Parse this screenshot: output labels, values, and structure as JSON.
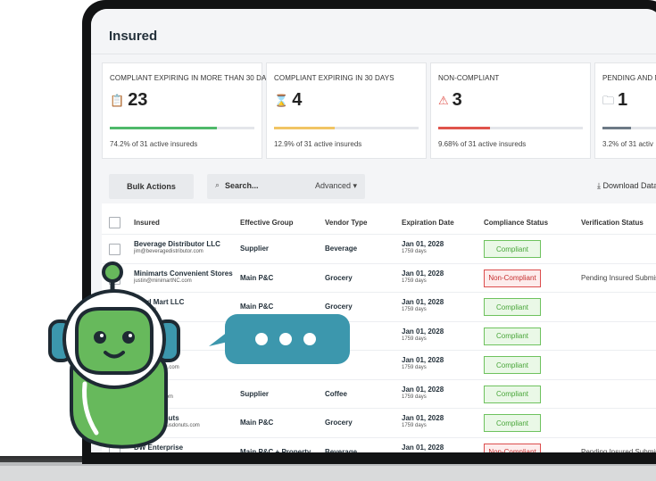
{
  "page_title": "Insured",
  "cards": [
    {
      "label": "COMPLIANT EXPIRING IN MORE THAN 30 DAYS",
      "value": "23",
      "icon": "clipboard-icon",
      "icon_glyph": "📋",
      "fraction": 0.742,
      "color": "#4fb96a",
      "sub": "74.2% of 31 active insureds"
    },
    {
      "label": "COMPLIANT EXPIRING IN 30 DAYS",
      "value": "4",
      "icon": "hourglass-icon",
      "icon_glyph": "⌛",
      "fraction": 0.42,
      "color": "#f1c564",
      "sub": "12.9% of 31 active insureds"
    },
    {
      "label": "NON-COMPLIANT",
      "value": "3",
      "icon": "warning-icon",
      "icon_glyph": "⚠",
      "fraction": 0.36,
      "color": "#e0534c",
      "sub": "9.68% of 31 active insureds"
    },
    {
      "label": "PENDING AND NE",
      "value": "1",
      "icon": "folder-icon",
      "icon_glyph": "🗀",
      "fraction": 0.2,
      "color": "#6d7a86",
      "sub": "3.2% of 31 activ"
    }
  ],
  "toolbar": {
    "bulk_actions": "Bulk Actions",
    "search_placeholder": "Search...",
    "advanced": "Advanced ▾",
    "download": "Download Data"
  },
  "table": {
    "headers": {
      "insured": "Insured",
      "group": "Effective Group",
      "vendor": "Vendor Type",
      "expiration": "Expiration Date",
      "compliance": "Compliance Status",
      "verification": "Verification Status"
    },
    "rows": [
      {
        "name": "Beverage Distributor LLC",
        "email": "jim@beveragedistributor.com",
        "group": "Supplier",
        "vendor": "Beverage",
        "date": "Jan 01, 2028",
        "days": "1759 days",
        "status": "Compliant",
        "ok": true,
        "verification": ""
      },
      {
        "name": "Minimarts Convenient Stores",
        "email": "justin@minimartNC.com",
        "group": "Main P&C",
        "vendor": "Grocery",
        "date": "Jan 01, 2028",
        "days": "1759 days",
        "status": "Non-Compliant",
        "ok": false,
        "verification": "Pending Insured Submissi"
      },
      {
        "name": "Food Mart LLC",
        "email": "mart.com",
        "group": "Main P&C",
        "vendor": "Grocery",
        "date": "Jan 01, 2028",
        "days": "1759 days",
        "status": "Compliant",
        "ok": true,
        "verification": ""
      },
      {
        "name": "",
        "email": "",
        "group": "",
        "vendor": "",
        "date": "Jan 01, 2028",
        "days": "1759 days",
        "status": "Compliant",
        "ok": true,
        "verification": ""
      },
      {
        "name": "Marts LLC",
        "email": "nvenientmarts.com",
        "group": "",
        "vendor": "",
        "date": "Jan 01, 2028",
        "days": "1759 days",
        "status": "Compliant",
        "ok": true,
        "verification": ""
      },
      {
        "name": "ess LLC",
        "email": "ffeeexpress.com",
        "group": "Supplier",
        "vendor": "Coffee",
        "date": "Jan 01, 2028",
        "days": "1759 days",
        "status": "Compliant",
        "ok": true,
        "verification": ""
      },
      {
        "name": "cious Donuts",
        "email": "noah@deliciousdonuts.com",
        "group": "Main P&C",
        "vendor": "Grocery",
        "date": "Jan 01, 2028",
        "days": "1759 days",
        "status": "Compliant",
        "ok": true,
        "verification": ""
      },
      {
        "name": "DW Enterprise",
        "email": "",
        "group": "Main P&C + Property",
        "vendor": "Beverage",
        "date": "Jan 01, 2028",
        "days": "1759 days",
        "status": "Non-Compliant",
        "ok": false,
        "verification": "Pending Insured Submissi"
      }
    ]
  },
  "chat_bubble": {
    "icon": "typing-dots-icon"
  },
  "colors": {
    "accent_teal": "#3c97ad",
    "mascot_green": "#67b95c",
    "mascot_dark": "#1e2a33"
  }
}
